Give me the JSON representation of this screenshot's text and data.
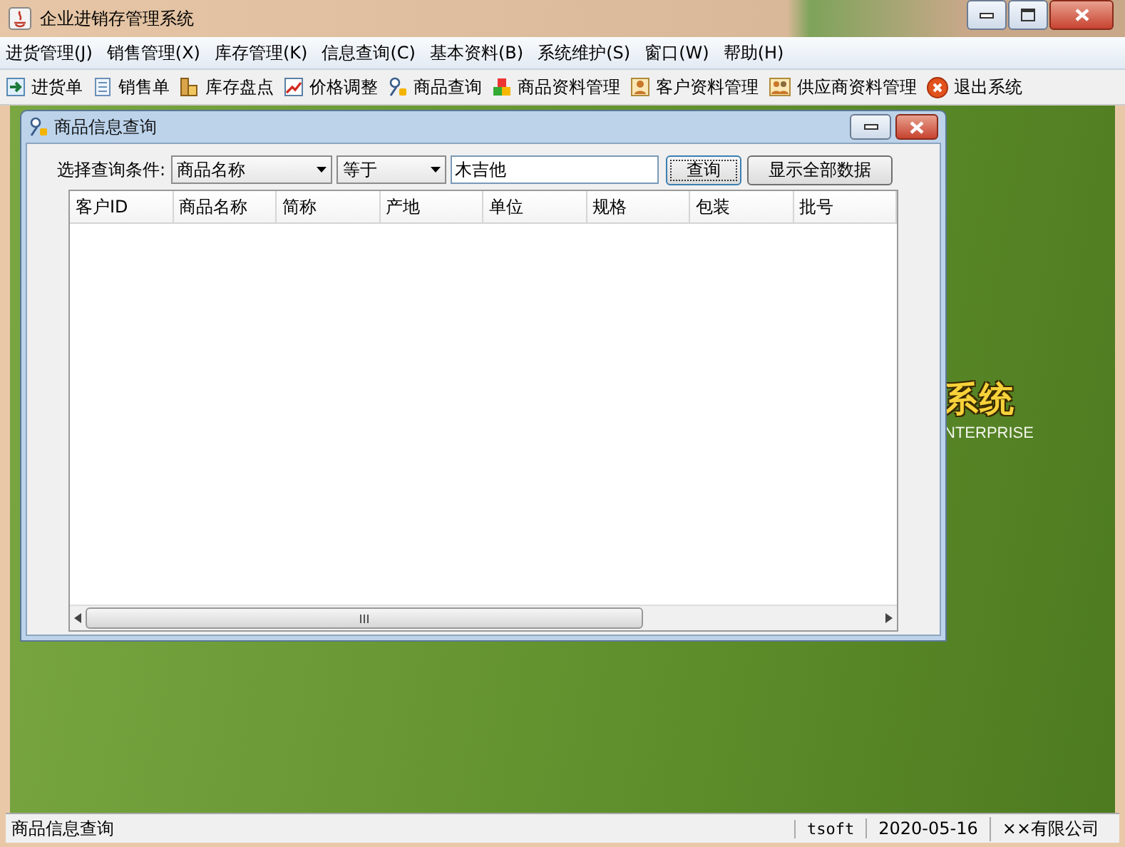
{
  "window": {
    "title": "企业进销存管理系统"
  },
  "menu": [
    "进货管理(J)",
    "销售管理(X)",
    "库存管理(K)",
    "信息查询(C)",
    "基本资料(B)",
    "系统维护(S)",
    "窗口(W)",
    "帮助(H)"
  ],
  "toolbar": [
    {
      "label": "进货单"
    },
    {
      "label": "销售单"
    },
    {
      "label": "库存盘点"
    },
    {
      "label": "价格调整"
    },
    {
      "label": "商品查询"
    },
    {
      "label": "商品资料管理"
    },
    {
      "label": "客户资料管理"
    },
    {
      "label": "供应商资料管理"
    },
    {
      "label": "退出系统"
    }
  ],
  "backdrop": {
    "logo_text": "系统",
    "logo_subtitle": "NTERPRISE"
  },
  "query_window": {
    "title": "商品信息查询",
    "condition_label": "选择查询条件:",
    "field_combo": "商品名称",
    "operator_combo": "等于",
    "search_value": "木吉他",
    "buttons": [
      "查询",
      "显示全部数据"
    ],
    "table": {
      "columns": [
        "客户ID",
        "商品名称",
        "简称",
        "产地",
        "单位",
        "规格",
        "包装",
        "批号"
      ]
    }
  },
  "status_bar": [
    "商品信息查询",
    "tsoft",
    "2020-05-16",
    "××有限公司"
  ]
}
